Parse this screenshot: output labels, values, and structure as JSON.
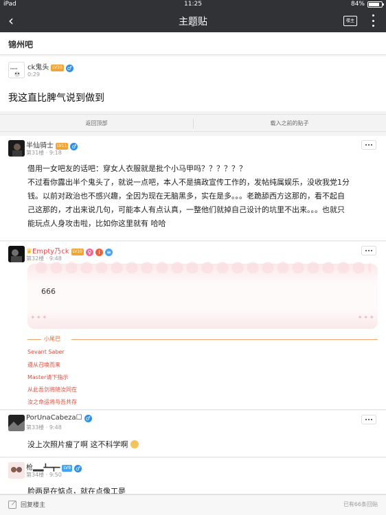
{
  "status": {
    "device": "iPad",
    "time": "11:25",
    "battery": "84%"
  },
  "nav": {
    "title": "主题贴",
    "caret": "⌃",
    "owner_label": "楼主"
  },
  "forum": {
    "name": "锦州吧"
  },
  "op": {
    "username": "ck鬼头",
    "level": "LV10",
    "time": "0:29",
    "title": "我这直比脾气说到做到"
  },
  "actions": {
    "back_to_top": "返回顶部",
    "load_previous": "载入之前的贴子"
  },
  "replies": [
    {
      "username": "半仙骑士",
      "level": "LV11",
      "gender": "♂",
      "floor": "第31楼",
      "time": "9:18",
      "lines": [
        "借用一女吧友的话吧：穿女人衣服就是批个小马甲吗？？？？？？",
        " 不过看你露出半个鬼头了，就说一点吧，本人不是搞政宣传工作的，发帖纯属娱乐，没收我党1分",
        "钱。以前对政治也不感兴趣，全因为现在无脑黑多，实在是多。。。老跪舔西方这那的，看不起自",
        "己这那的，才出来说几句，可能本人有点认真，一整他们就掉自己设计的坑里不出来。。。也就只",
        "能玩点人身攻击啦，比如你这里就有 哈哈"
      ]
    },
    {
      "username": "Empty乃ck",
      "level": "LV10",
      "floor": "第32楼",
      "time": "9:48",
      "bubble": "666",
      "signature_label": "小尾巴",
      "signature": [
        "Sevant Saber",
        "遵从召唤而来",
        "Master请下指示",
        "从此吾剑将随汝同在",
        "汝之命运将与吾共存"
      ]
    },
    {
      "username": "PorUnaCabeza☐",
      "gender": "♂",
      "floor": "第33楼",
      "time": "9:48",
      "text": "没上次照片瘦了啊 这不科学啊"
    },
    {
      "username": "枪▂▂┻━┳━",
      "level": "LV9",
      "gender": "♂",
      "floor": "第34楼",
      "time": "9:50",
      "text": "脸两是在惦点，就在点像工是"
    }
  ],
  "bottom": {
    "reply_placeholder": "回复楼主",
    "reply_count": "已有66条回贴"
  },
  "colors": {
    "topbar": "#313236",
    "level_badge": "#f0a53b",
    "male": "#2f8fe8",
    "female": "#f0649a",
    "signature": "#e04a3a"
  }
}
